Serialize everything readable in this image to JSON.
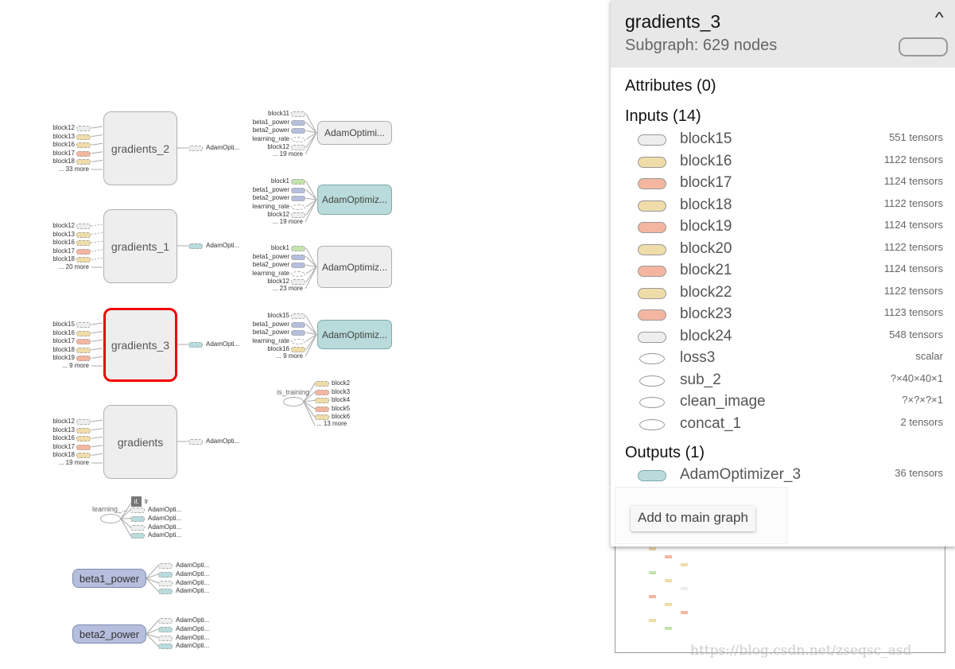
{
  "colors": {
    "grey": "#eeeeee",
    "tan": "#f0dca8",
    "salmon": "#f4b6a0",
    "bluegrey": "#b5bedc",
    "teal": "#b9dbdb",
    "green": "#c5e3ad",
    "white": "#ffffff",
    "selected": "#f20000"
  },
  "graph": {
    "gradient_groups": [
      {
        "name": "gradients_2",
        "selected": false,
        "inputs": [
          {
            "label": "block12",
            "color": "grey"
          },
          {
            "label": "block13",
            "color": "tan"
          },
          {
            "label": "block16",
            "color": "tan"
          },
          {
            "label": "block17",
            "color": "salmon"
          },
          {
            "label": "block18",
            "color": "tan"
          }
        ],
        "more": "... 33 more",
        "output": {
          "label": "AdamOpti...",
          "color": "grey"
        }
      },
      {
        "name": "gradients_1",
        "selected": false,
        "inputs": [
          {
            "label": "block12",
            "color": "grey"
          },
          {
            "label": "block13",
            "color": "tan"
          },
          {
            "label": "block16",
            "color": "tan"
          },
          {
            "label": "block17",
            "color": "salmon"
          },
          {
            "label": "block18",
            "color": "tan"
          }
        ],
        "more": "... 20 more",
        "output": {
          "label": "AdamOpti...",
          "color": "teal"
        }
      },
      {
        "name": "gradients_3",
        "selected": true,
        "inputs": [
          {
            "label": "block15",
            "color": "grey"
          },
          {
            "label": "block16",
            "color": "tan"
          },
          {
            "label": "block17",
            "color": "salmon"
          },
          {
            "label": "block18",
            "color": "tan"
          },
          {
            "label": "block19",
            "color": "salmon"
          }
        ],
        "more": "... 9 more",
        "output": {
          "label": "AdamOpti...",
          "color": "teal"
        }
      },
      {
        "name": "gradients",
        "selected": false,
        "inputs": [
          {
            "label": "block12",
            "color": "grey"
          },
          {
            "label": "block13",
            "color": "tan"
          },
          {
            "label": "block16",
            "color": "tan"
          },
          {
            "label": "block17",
            "color": "salmon"
          },
          {
            "label": "block18",
            "color": "tan"
          }
        ],
        "more": "... 19 more",
        "output": {
          "label": "AdamOpti...",
          "color": "grey"
        }
      }
    ],
    "adam_groups": [
      {
        "name": "AdamOptimi...",
        "color": "grey",
        "inputs": [
          {
            "label": "block11",
            "color": "grey"
          },
          {
            "label": "beta1_power",
            "color": "bluegrey"
          },
          {
            "label": "beta2_power",
            "color": "bluegrey"
          },
          {
            "label": "learning_rate",
            "color": "white"
          },
          {
            "label": "block12",
            "color": "grey"
          }
        ],
        "more": "... 19 more"
      },
      {
        "name": "AdamOptimiz...",
        "color": "teal",
        "inputs": [
          {
            "label": "block1",
            "color": "green"
          },
          {
            "label": "beta1_power",
            "color": "bluegrey"
          },
          {
            "label": "beta2_power",
            "color": "bluegrey"
          },
          {
            "label": "learning_rate",
            "color": "white"
          },
          {
            "label": "block12",
            "color": "grey"
          }
        ],
        "more": "... 19 more"
      },
      {
        "name": "AdamOptimiz...",
        "color": "grey",
        "inputs": [
          {
            "label": "block1",
            "color": "green"
          },
          {
            "label": "beta1_power",
            "color": "bluegrey"
          },
          {
            "label": "beta2_power",
            "color": "bluegrey"
          },
          {
            "label": "learning_rate",
            "color": "white"
          },
          {
            "label": "block12",
            "color": "grey"
          }
        ],
        "more": "... 23 more"
      },
      {
        "name": "AdamOptimiz...",
        "color": "teal",
        "inputs": [
          {
            "label": "block15",
            "color": "grey"
          },
          {
            "label": "beta1_power",
            "color": "bluegrey"
          },
          {
            "label": "beta2_power",
            "color": "bluegrey"
          },
          {
            "label": "learning_rate",
            "color": "white"
          },
          {
            "label": "block16",
            "color": "tan"
          }
        ],
        "more": "... 9 more"
      }
    ],
    "is_training": {
      "name": "is_training",
      "outputs": [
        {
          "label": "block2",
          "color": "tan"
        },
        {
          "label": "block3",
          "color": "salmon"
        },
        {
          "label": "block4",
          "color": "tan"
        },
        {
          "label": "block5",
          "color": "salmon"
        },
        {
          "label": "block6",
          "color": "tan"
        }
      ],
      "more": "... 13 more"
    },
    "learning_rate": {
      "name": "learning_...",
      "summary_label": "lr",
      "outputs": [
        {
          "label": "AdamOpti...",
          "color": "grey"
        },
        {
          "label": "AdamOpti...",
          "color": "teal"
        },
        {
          "label": "AdamOpti...",
          "color": "grey"
        },
        {
          "label": "AdamOpti...",
          "color": "teal"
        }
      ]
    },
    "powers": [
      {
        "name": "beta1_power",
        "outputs": [
          {
            "label": "AdamOpti...",
            "color": "grey"
          },
          {
            "label": "AdamOpti...",
            "color": "teal"
          },
          {
            "label": "AdamOpti...",
            "color": "grey"
          },
          {
            "label": "AdamOpti...",
            "color": "teal"
          }
        ]
      },
      {
        "name": "beta2_power",
        "outputs": [
          {
            "label": "AdamOpti...",
            "color": "grey"
          },
          {
            "label": "AdamOpti...",
            "color": "teal"
          },
          {
            "label": "AdamOpti...",
            "color": "grey"
          },
          {
            "label": "AdamOpti...",
            "color": "teal"
          }
        ]
      }
    ]
  },
  "panel": {
    "title": "gradients_3",
    "subtitle": "Subgraph: 629 nodes",
    "attributes_heading": "Attributes (0)",
    "inputs_heading": "Inputs (14)",
    "inputs": [
      {
        "name": "block15",
        "count": "551 tensors",
        "shape": "pill",
        "color": "grey"
      },
      {
        "name": "block16",
        "count": "1122 tensors",
        "shape": "pill",
        "color": "tan"
      },
      {
        "name": "block17",
        "count": "1124 tensors",
        "shape": "pill",
        "color": "salmon"
      },
      {
        "name": "block18",
        "count": "1122 tensors",
        "shape": "pill",
        "color": "tan"
      },
      {
        "name": "block19",
        "count": "1124 tensors",
        "shape": "pill",
        "color": "salmon"
      },
      {
        "name": "block20",
        "count": "1122 tensors",
        "shape": "pill",
        "color": "tan"
      },
      {
        "name": "block21",
        "count": "1124 tensors",
        "shape": "pill",
        "color": "salmon"
      },
      {
        "name": "block22",
        "count": "1122 tensors",
        "shape": "pill",
        "color": "tan"
      },
      {
        "name": "block23",
        "count": "1123 tensors",
        "shape": "pill",
        "color": "salmon"
      },
      {
        "name": "block24",
        "count": "548 tensors",
        "shape": "pill",
        "color": "grey"
      },
      {
        "name": "loss3",
        "count": "scalar",
        "shape": "ellipse",
        "color": "white"
      },
      {
        "name": "sub_2",
        "count": "?×40×40×1",
        "shape": "ellipse",
        "color": "white"
      },
      {
        "name": "clean_image",
        "count": "?×?×?×1",
        "shape": "ellipse",
        "color": "white"
      },
      {
        "name": "concat_1",
        "count": "2 tensors",
        "shape": "ellipse",
        "color": "white"
      }
    ],
    "outputs_heading": "Outputs (1)",
    "outputs": [
      {
        "name": "AdamOptimizer_3",
        "count": "36 tensors",
        "shape": "pill",
        "color": "teal"
      }
    ],
    "add_button": "Add to main graph",
    "collapse_icon": "chevron-up-icon"
  },
  "watermark": "https://blog.csdn.net/zseqsc_asd"
}
